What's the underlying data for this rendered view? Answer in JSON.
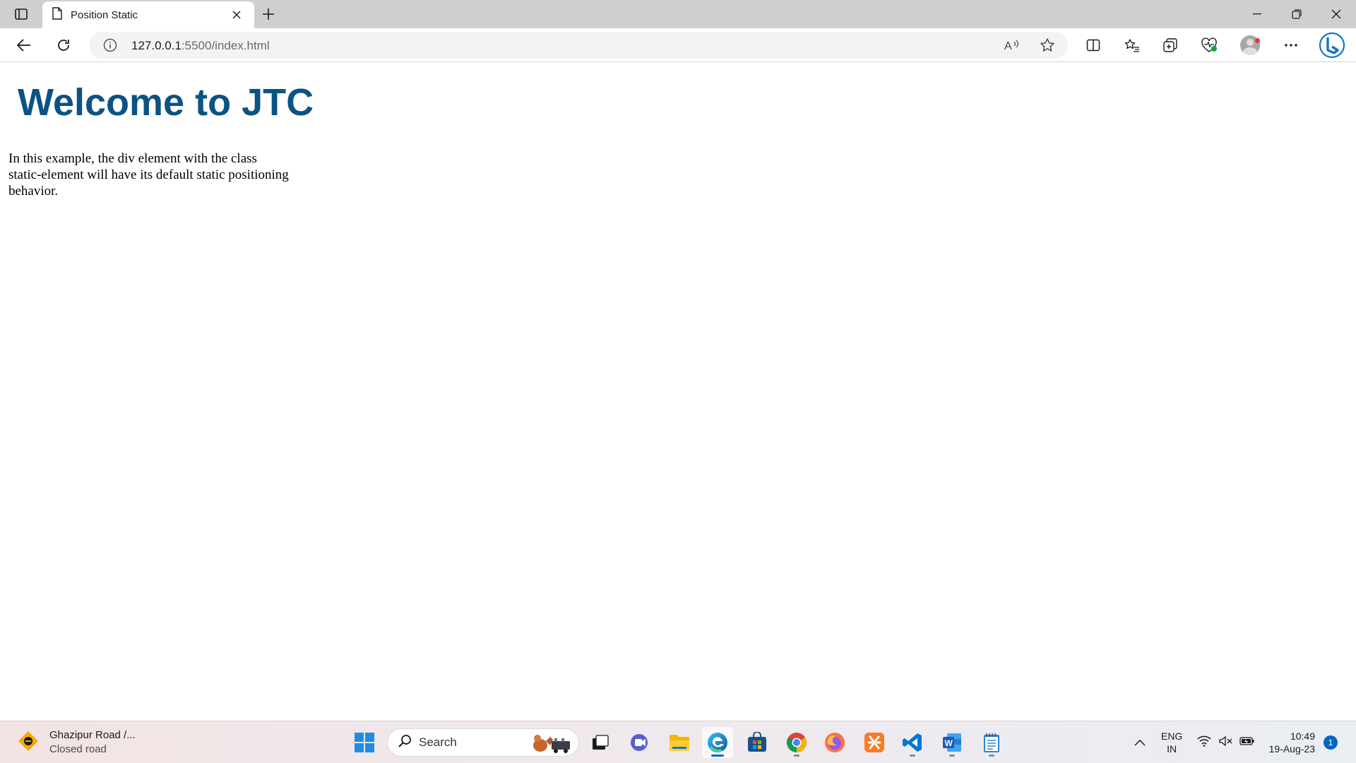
{
  "browser": {
    "tab": {
      "title": "Position Static"
    },
    "address": {
      "url_host": "127.0.0.1",
      "url_rest": ":5500/index.html"
    }
  },
  "page": {
    "heading": "Welcome to JTC",
    "paragraph": "In this example, the div element with the class static-element will have its default static positioning behavior.",
    "heading_color": "#0b5383"
  },
  "taskbar": {
    "weather": {
      "title": "Ghazipur Road /...",
      "subtitle": "Closed road"
    },
    "search": {
      "label": "Search"
    },
    "apps": [
      "windows-start",
      "teams-meet",
      "file-explorer",
      "edge",
      "microsoft-store",
      "chrome",
      "firefox",
      "xampp",
      "vscode",
      "word",
      "notepad"
    ],
    "tray": {
      "lang_top": "ENG",
      "lang_bottom": "IN",
      "time": "10:49",
      "date": "19-Aug-23",
      "notification_count": "1"
    }
  }
}
